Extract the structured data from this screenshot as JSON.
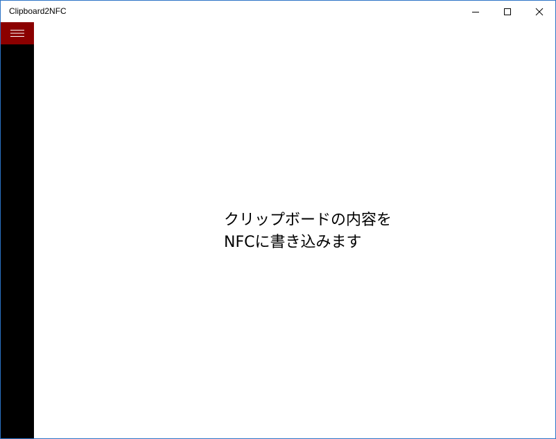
{
  "window": {
    "title": "Clipboard2NFC"
  },
  "icons": {
    "minimize": "minimize-icon",
    "maximize": "maximize-icon",
    "close": "close-icon",
    "menu": "hamburger-menu-icon"
  },
  "colors": {
    "accent": "#8b0000",
    "sidebar": "#000000",
    "window_border": "#2b73c6"
  },
  "main": {
    "message_line1": "クリップボードの内容を",
    "message_line2": "NFCに書き込みます"
  }
}
